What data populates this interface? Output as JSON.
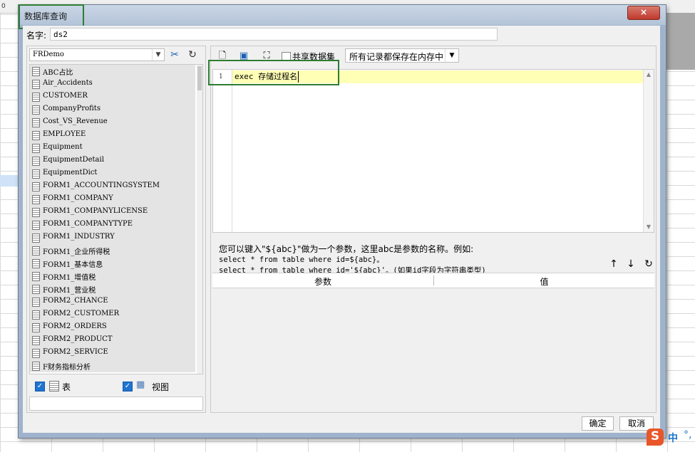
{
  "dialog": {
    "title": "数据库查询",
    "close_icon": "×"
  },
  "name_field": {
    "label": "名字:",
    "value": "ds2"
  },
  "left_panel": {
    "database_select": "FRDemo",
    "tables": [
      "ABC占比",
      "Air_Accidents",
      "CUSTOMER",
      "CompanyProfits",
      "Cost_VS_Revenue",
      "EMPLOYEE",
      "Equipment",
      "EquipmentDetail",
      "EquipmentDict",
      "FORM1_ACCOUNTINGSYSTEM",
      "FORM1_COMPANY",
      "FORM1_COMPANYLICENSE",
      "FORM1_COMPANYTYPE",
      "FORM1_INDUSTRY",
      "FORM1_企业所得税",
      "FORM1_基本信息",
      "FORM1_增值税",
      "FORM1_营业税",
      "FORM2_CHANCE",
      "FORM2_CUSTOMER",
      "FORM2_ORDERS",
      "FORM2_PRODUCT",
      "FORM2_SERVICE",
      "F财务指标分析"
    ],
    "filter_table_label": "表",
    "filter_view_label": "视图",
    "filter_table_checked": true,
    "filter_view_checked": true
  },
  "right_panel": {
    "share_label": "共享数据集",
    "share_checked": false,
    "mode_select": "所有记录都保存在内存中",
    "editor": {
      "line_number": "1",
      "code": "exec 存储过程名"
    },
    "hint_line1": "您可以键入\"${abc}\"做为一个参数，这里abc是参数的名称。例如:",
    "hint_line2": "select * from table where id=${abc}。",
    "hint_line3": "select * from table where id='${abc}'。(如果id字段为字符串类型)",
    "param_table": {
      "col_param": "参数",
      "col_value": "值"
    }
  },
  "footer": {
    "ok_label": "确定",
    "cancel_label": "取消"
  },
  "ime": {
    "logo": "S",
    "mode": "中",
    "dots": "°,"
  },
  "background": {
    "row_header": "0"
  }
}
